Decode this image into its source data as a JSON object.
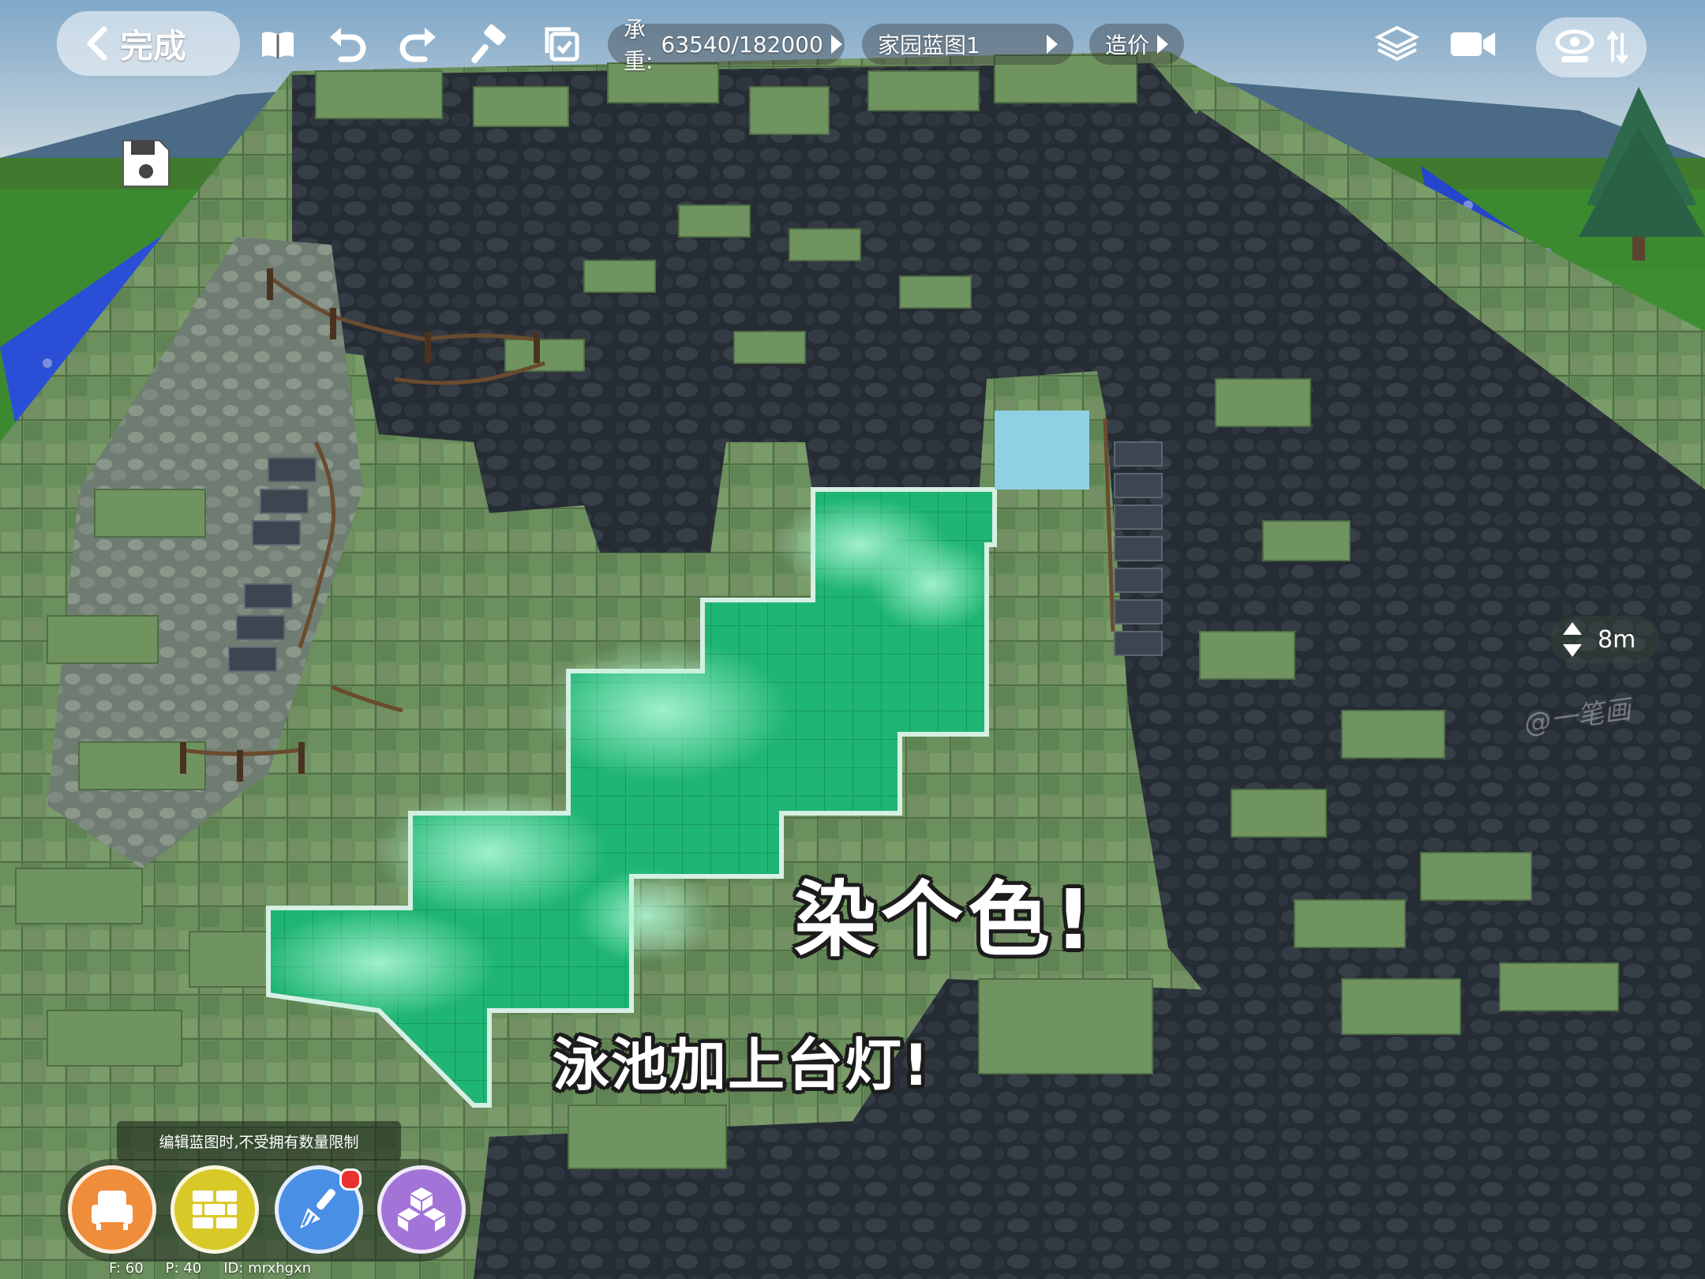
{
  "toolbar": {
    "done_label": "完成",
    "weight_label": "承重:",
    "weight_value": "63540/182000",
    "blueprint_name": "家园蓝图1",
    "price_label": "造价",
    "icons": [
      "back-chevron-icon",
      "book-icon",
      "undo-icon",
      "redo-icon",
      "hammer-icon",
      "checklist-icon",
      "grid-view-icon",
      "camera-icon",
      "eye-icon",
      "swap-arrows-icon"
    ]
  },
  "side": {
    "save_icon": "save-icon",
    "height_value": "8m"
  },
  "captions": {
    "line1": "染个色!",
    "line2": "泳池加上台灯!"
  },
  "bottom": {
    "hint": "编辑蓝图时,不受拥有数量限制",
    "tools": [
      "furniture",
      "build",
      "dye",
      "blocks"
    ],
    "status_f": "F: 60",
    "status_p": "P: 40",
    "status_id": "ID: mrxhgxn"
  },
  "colors": {
    "pool": "#2fd88e",
    "grass": "#6a8f5c",
    "rock": "#2a3038",
    "fence": "#2a4fd6"
  }
}
